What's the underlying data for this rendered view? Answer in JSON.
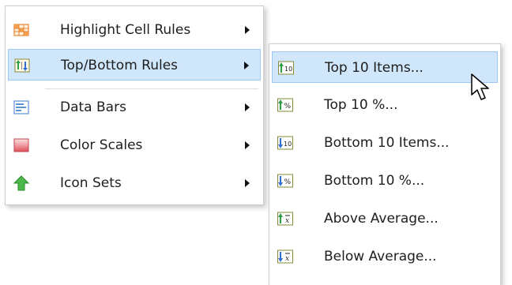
{
  "main_menu": {
    "items": [
      {
        "label": "Highlight Cell Rules",
        "icon": "highlight-cell-rules-icon"
      },
      {
        "label": "Top/Bottom Rules",
        "icon": "top-bottom-rules-icon"
      },
      {
        "label": "Data Bars",
        "icon": "data-bars-icon"
      },
      {
        "label": "Color Scales",
        "icon": "color-scales-icon"
      },
      {
        "label": "Icon Sets",
        "icon": "icon-sets-icon"
      }
    ]
  },
  "sub_menu": {
    "items": [
      {
        "label": "Top 10 Items...",
        "icon": "top-10-items-icon"
      },
      {
        "label": "Top 10 %...",
        "icon": "top-10-percent-icon"
      },
      {
        "label": "Bottom 10 Items...",
        "icon": "bottom-10-items-icon"
      },
      {
        "label": "Bottom 10 %...",
        "icon": "bottom-10-percent-icon"
      },
      {
        "label": "Above Average...",
        "icon": "above-average-icon"
      },
      {
        "label": "Below Average...",
        "icon": "below-average-icon"
      }
    ]
  },
  "colors": {
    "selection_bg": "#cfe6fb",
    "selection_border": "#9ec8ef",
    "icon_green": "#2ea043",
    "icon_blue": "#2f6fd6"
  }
}
